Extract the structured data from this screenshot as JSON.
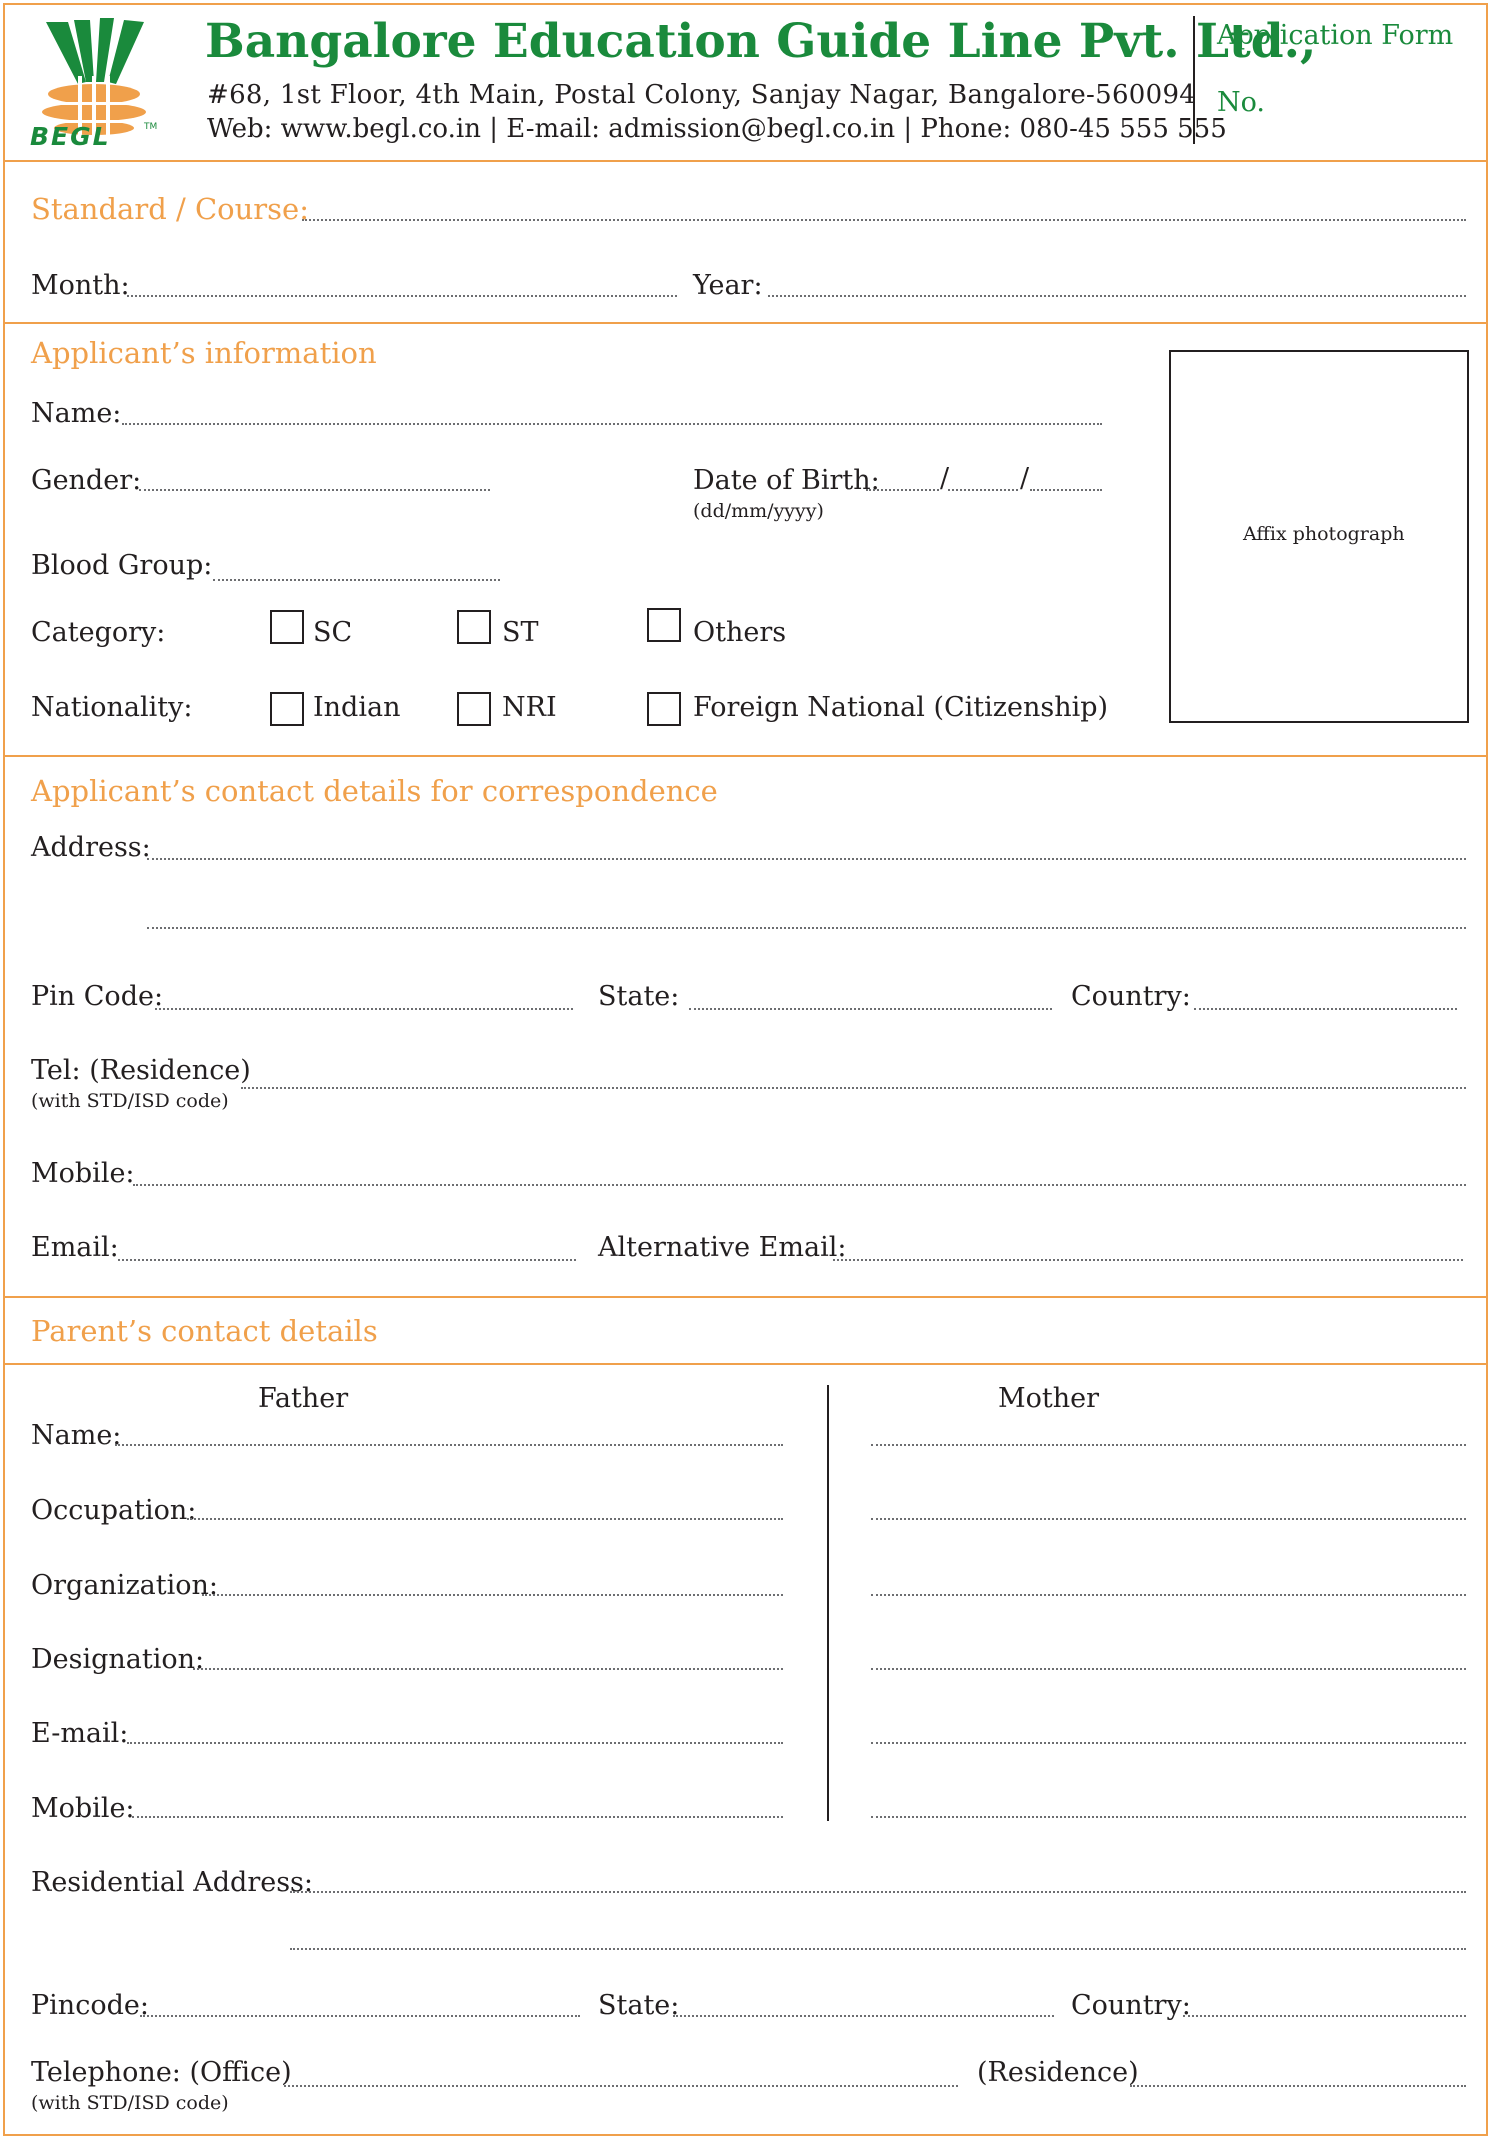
{
  "header": {
    "logo_text": "BEGL",
    "logo_tm": "TM",
    "company_name": "Bangalore Education Guide Line  Pvt. Ltd.,",
    "address_line": "#68, 1st Floor, 4th Main, Postal Colony, Sanjay Nagar, Bangalore-560094",
    "contact_line": "Web: www.begl.co.in | E-mail: admission@begl.co.in  | Phone: 080-45 555 555",
    "form_title": "Application Form",
    "form_no_label": "No."
  },
  "course": {
    "standard_label": "Standard / Course:",
    "month_label": "Month:",
    "year_label": "Year:"
  },
  "applicant": {
    "heading": "Applicant’s information",
    "name_label": "Name:",
    "gender_label": "Gender:",
    "dob_label": "Date of Birth:",
    "dob_sep": "/",
    "dob_format": "(dd/mm/yyyy)",
    "blood_group_label": "Blood Group:",
    "category_label": "Category:",
    "category_options": [
      "SC",
      "ST",
      "Others"
    ],
    "nationality_label": "Nationality:",
    "nationality_options": [
      "Indian",
      "NRI",
      "Foreign National (Citizenship)"
    ],
    "photo_label": "Affix photograph"
  },
  "contact": {
    "heading": "Applicant’s contact details for correspondence",
    "address_label": "Address:",
    "pin_label": "Pin Code:",
    "state_label": "State:",
    "country_label": "Country:",
    "tel_label": "Tel: (Residence)",
    "tel_note": "(with STD/ISD code)",
    "mobile_label": "Mobile:",
    "email_label": "Email:",
    "alt_email_label": "Alternative Email:"
  },
  "parents": {
    "heading": "Parent’s contact details",
    "father_label": "Father",
    "mother_label": "Mother",
    "name_label": "Name:",
    "occupation_label": "Occupation:",
    "organization_label": "Organization:",
    "designation_label": "Designation:",
    "email_label": "E-mail:",
    "mobile_label": "Mobile:",
    "res_address_label": "Residential Address:",
    "pincode_label": "Pincode:",
    "state_label": "State:",
    "country_label": "Country:",
    "tel_office_label": "Telephone: (Office)",
    "tel_note": "(with STD/ISD code)",
    "residence_label": "(Residence)"
  },
  "colors": {
    "accent": "#f0a04b",
    "brand": "#1a8a3c",
    "text": "#231f20"
  }
}
